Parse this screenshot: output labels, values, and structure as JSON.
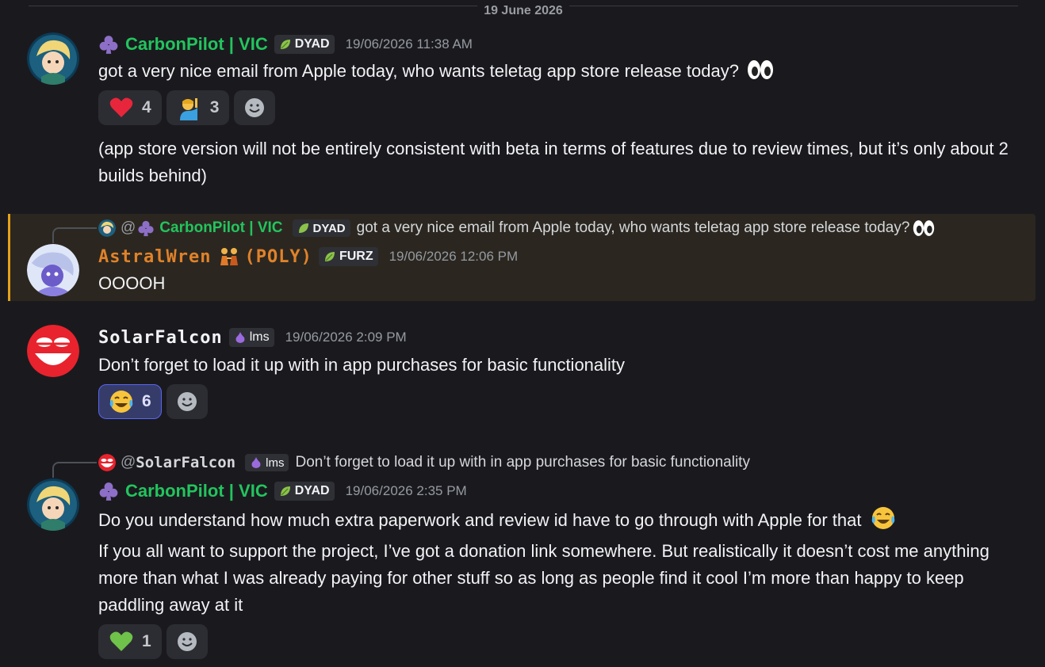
{
  "date_divider": "19 June 2026",
  "messages": [
    {
      "username": "CarbonPilot | VIC",
      "tag": "DYAD",
      "timestamp": "19/06/2026 11:38 AM",
      "lines": [
        "got a very nice email from Apple today, who wants teletag app store release today?"
      ],
      "reactions": [
        {
          "emoji": "red-heart",
          "count": "4"
        },
        {
          "emoji": "person-raising-hand",
          "count": "3"
        }
      ],
      "followup": "(app store version will not be entirely consistent with beta in terms of features due to review times, but it’s only about 2 builds behind)"
    },
    {
      "reply_to": {
        "at": "@",
        "username": "CarbonPilot | VIC",
        "tag": "DYAD",
        "text": "got a very nice email from Apple today, who wants teletag app store release today?"
      },
      "username": "AstralWren",
      "username_suffix": "(POLY)",
      "tag": "FURZ",
      "timestamp": "19/06/2026 12:06 PM",
      "lines": [
        "OOOOH"
      ]
    },
    {
      "username": "SolarFalcon",
      "tag": "lms",
      "timestamp": "19/06/2026 2:09 PM",
      "lines": [
        "Don’t forget to load it up with in app purchases for basic functionality"
      ],
      "reactions": [
        {
          "emoji": "face-with-tears-of-joy",
          "count": "6",
          "active": true
        }
      ]
    },
    {
      "reply_to": {
        "at": "@",
        "username": "SolarFalcon",
        "tag": "lms",
        "text": "Don’t forget to load it up with in app purchases for basic functionality"
      },
      "username": "CarbonPilot | VIC",
      "tag": "DYAD",
      "timestamp": "19/06/2026 2:35 PM",
      "lines": [
        "Do you understand how much extra paperwork and review id have to go through with Apple for that",
        "If you all want to support the project, I’ve got a donation link somewhere. But realistically it doesn’t cost me anything more than what I was already paying for other stuff so as long as people find it cool I’m more than happy to keep paddling away at it"
      ],
      "reactions": [
        {
          "emoji": "green-heart",
          "count": "1"
        }
      ]
    }
  ],
  "colors": {
    "accent": "#5865f2",
    "username_green": "#23c45e",
    "username_orange": "#e0822a",
    "highlight_border": "#e3a21a"
  }
}
